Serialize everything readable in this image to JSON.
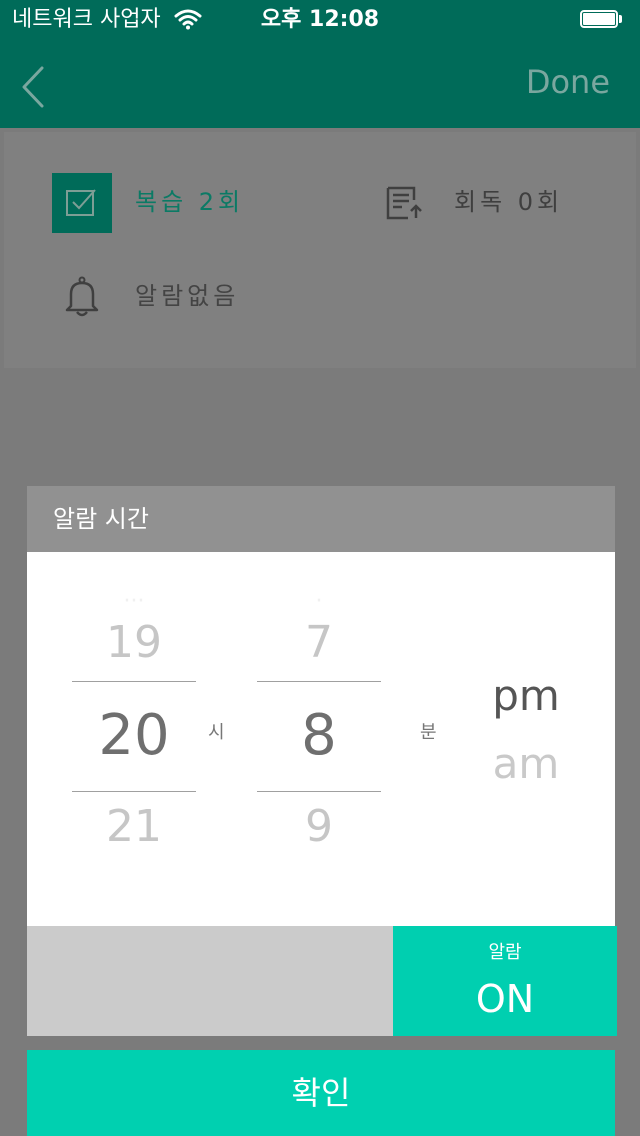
{
  "status_bar": {
    "carrier": "네트워크 사업자",
    "time": "오후 12:08",
    "wifi_icon": "wifi-icon",
    "battery_icon": "battery-full-icon"
  },
  "nav": {
    "back_icon": "chevron-left-icon",
    "done_label": "Done"
  },
  "info": {
    "review": {
      "label": "복습 2회",
      "icon": "review-check-icon"
    },
    "read": {
      "label": "회독 0회",
      "icon": "read-document-icon"
    },
    "alarm": {
      "label": "알람없음",
      "icon": "bell-icon"
    }
  },
  "dialog": {
    "title": "알람 시간",
    "hour": {
      "prev": "19",
      "selected": "20",
      "next": "21",
      "unit": "시"
    },
    "minute": {
      "prev": "7",
      "selected": "8",
      "next": "9",
      "unit": "분"
    },
    "ampm": {
      "selected": "pm",
      "other": "am"
    },
    "alarm_toggle": {
      "caption": "알람",
      "state": "ON"
    },
    "confirm_label": "확인"
  },
  "colors": {
    "primary_dark": "#006b59",
    "accent": "#00d0b0",
    "overlay": "#7b7b7b"
  }
}
